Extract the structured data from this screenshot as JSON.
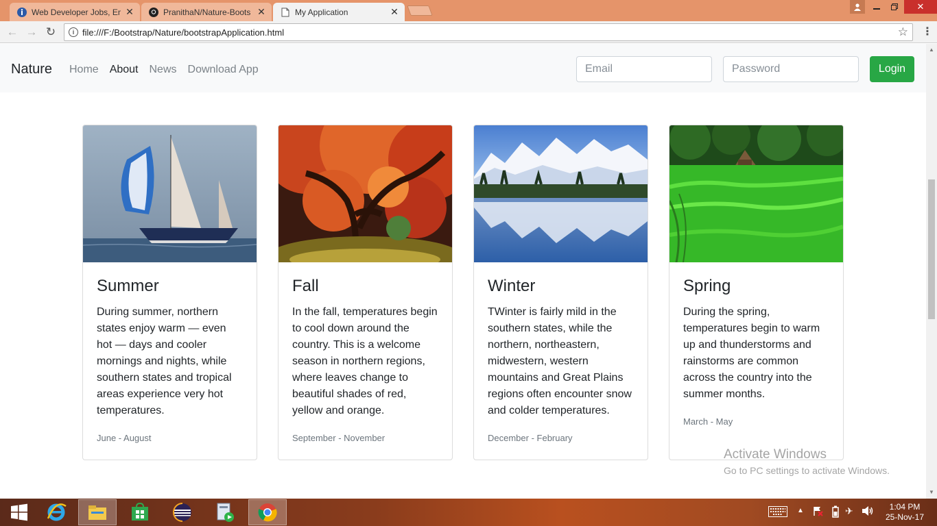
{
  "browser": {
    "tabs": [
      {
        "title": "Web Developer Jobs, Em",
        "icon": "indeed-icon",
        "active": false
      },
      {
        "title": "PranithaN/Nature-Boots",
        "icon": "github-icon",
        "active": false
      },
      {
        "title": "My Application",
        "icon": "page-icon",
        "active": true
      }
    ],
    "url": "file:///F:/Bootstrap/Nature/bootstrapApplication.html"
  },
  "site": {
    "brand": "Nature",
    "nav": [
      {
        "label": "Home",
        "active": false
      },
      {
        "label": "About",
        "active": true
      },
      {
        "label": "News",
        "active": false
      },
      {
        "label": "Download App",
        "active": false
      }
    ],
    "email_placeholder": "Email",
    "password_placeholder": "Password",
    "login_label": "Login",
    "accent_color": "#28a745"
  },
  "cards": [
    {
      "title": "Summer",
      "text": "During summer, northern states enjoy warm — even hot — days and cooler mornings and nights, while southern states and tropical areas experience very hot temperatures.",
      "months": "June - August",
      "image": "sailboat-on-sea"
    },
    {
      "title": "Fall",
      "text": "In the fall, temperatures begin to cool down around the country. This is a welcome season in northern regions, where leaves change to beautiful shades of red, yellow and orange.",
      "months": "September - November",
      "image": "autumn-maple-tree"
    },
    {
      "title": "Winter",
      "text": "TWinter is fairly mild in the southern states, while the northern, northeastern, midwestern, western mountains and Great Plains regions often encounter snow and colder temperatures.",
      "months": "December - February",
      "image": "snowy-mountains-lake"
    },
    {
      "title": "Spring",
      "text": "During the spring, temperatures begin to warm up and thunderstorms and rainstorms are common across the country into the summer months.",
      "months": "March - May",
      "image": "green-rice-field"
    }
  ],
  "watermark": {
    "line1": "Activate Windows",
    "line2": "Go to PC settings to activate Windows."
  },
  "taskbar": {
    "time": "1:04 PM",
    "date": "25-Nov-17"
  }
}
